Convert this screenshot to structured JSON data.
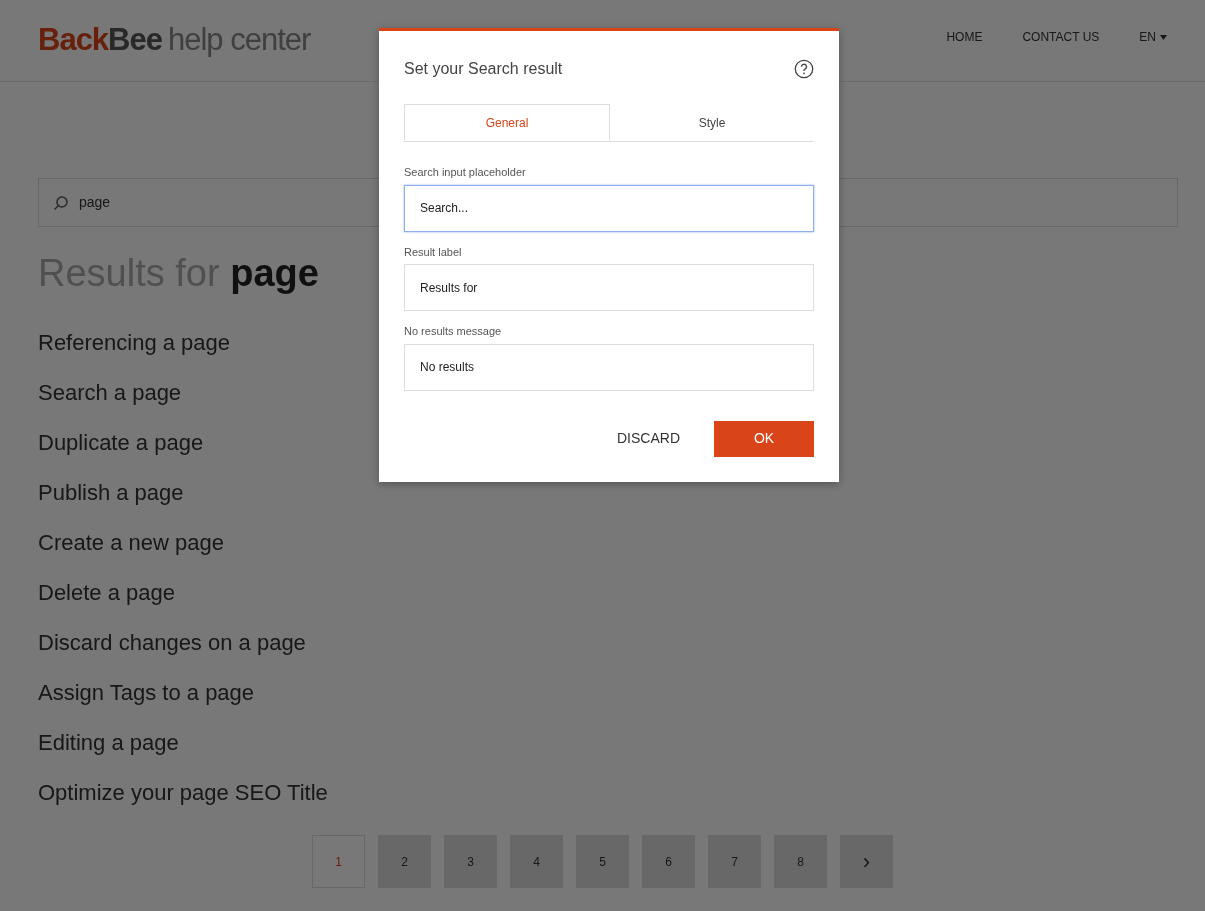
{
  "logo": {
    "brand_first": "Back",
    "brand_second": "Bee",
    "suffix": "help center"
  },
  "nav": [
    {
      "label": "HOME",
      "kind": "link"
    },
    {
      "label": "CONTACT US",
      "kind": "link"
    },
    {
      "label": "EN",
      "kind": "dropdown"
    }
  ],
  "search": {
    "value": "page"
  },
  "results_heading": "Results for **page**",
  "results": [
    "Referencing a page",
    "Search a page",
    "Duplicate a page",
    "Publish a page",
    "Create a new page",
    "Delete a page",
    "Discard changes on a page",
    "Assign Tags to a page",
    "Editing a page",
    "Optimize your page SEO Title"
  ],
  "pagination": [
    {
      "label": "1",
      "selected": true
    },
    {
      "label": "2",
      "selected": false
    },
    {
      "label": "3",
      "selected": false
    },
    {
      "label": "4",
      "selected": false
    },
    {
      "label": "5",
      "selected": false
    },
    {
      "label": "6",
      "selected": false
    },
    {
      "label": "7",
      "selected": false
    },
    {
      "label": "8",
      "selected": false
    }
  ],
  "pagination_next": "›",
  "dialog": {
    "title": "Set your Search result",
    "tabs": [
      {
        "label": "General",
        "selected": true
      },
      {
        "label": "Style",
        "selected": false
      }
    ],
    "fields": [
      {
        "label": "Search input placeholder",
        "value": "Search...",
        "focused": true
      },
      {
        "label": "Result label",
        "value": "Results for",
        "focused": false
      },
      {
        "label": "No results message",
        "value": "No results",
        "focused": false
      }
    ],
    "buttons": [
      {
        "label": "DISCARD",
        "kind": "secondary"
      },
      {
        "label": "OK",
        "kind": "primary"
      }
    ]
  }
}
